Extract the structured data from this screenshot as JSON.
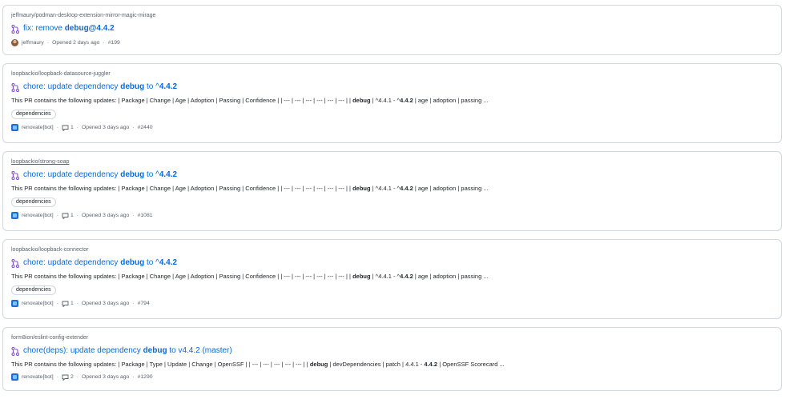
{
  "results": [
    {
      "repo": "jeffmaury/podman-desktop-extension-mirror-magic-mirage",
      "title_prefix": "fix: remove ",
      "title_bold": "debug@4.4.2",
      "title_suffix": "",
      "author": "jeffmaury",
      "opened": "Opened 2 days ago",
      "number": "#199"
    },
    {
      "repo": "loopbackio/loopback-datasource-juggler",
      "title_prefix": "chore: update dependency ",
      "title_bold": "debug",
      "title_mid": " to ^",
      "title_bold2": "4.4.2",
      "desc_pre": "This PR contains the following updates: | Package | Change | Age | Adoption | Passing | Confidence | | --- | --- | --- | --- | --- | --- | | ",
      "desc_b1": "debug",
      "desc_mid": " | ^4.4.1 - ^",
      "desc_b2": "4.4.2",
      "desc_post": " | age | adoption | passing ...",
      "label": "dependencies",
      "author": "renovate[bot]",
      "comments": "1",
      "opened": "Opened 3 days ago",
      "number": "#2440"
    },
    {
      "repo": "loopbackio/strong-soap",
      "title_prefix": "chore: update dependency ",
      "title_bold": "debug",
      "title_mid": " to ^",
      "title_bold2": "4.4.2",
      "desc_pre": "This PR contains the following updates: | Package | Change | Age | Adoption | Passing | Confidence | | --- | --- | --- | --- | --- | --- | | ",
      "desc_b1": "debug",
      "desc_mid": " | ^4.4.1 - ^",
      "desc_b2": "4.4.2",
      "desc_post": " | age | adoption | passing ...",
      "label": "dependencies",
      "author": "renovate[bot]",
      "comments": "1",
      "opened": "Opened 3 days ago",
      "number": "#1081"
    },
    {
      "repo": "loopbackio/loopback-connector",
      "title_prefix": "chore: update dependency ",
      "title_bold": "debug",
      "title_mid": " to ^",
      "title_bold2": "4.4.2",
      "desc_pre": "This PR contains the following updates: | Package | Change | Age | Adoption | Passing | Confidence | | --- | --- | --- | --- | --- | --- | | ",
      "desc_b1": "debug",
      "desc_mid": " | ^4.4.1 - ^",
      "desc_b2": "4.4.2",
      "desc_post": " | age | adoption | passing ...",
      "label": "dependencies",
      "author": "renovate[bot]",
      "comments": "1",
      "opened": "Opened 3 days ago",
      "number": "#794"
    },
    {
      "repo": "form8ion/eslint-config-extender",
      "title_prefix": "chore(deps): update dependency ",
      "title_bold": "debug",
      "title_mid": " to v4.4.2 (master)",
      "title_bold2": "",
      "desc_pre": "This PR contains the following updates: | Package | Type | Update | Change | OpenSSF | | --- | --- | --- | --- | --- | | ",
      "desc_b1": "debug",
      "desc_mid": " | devDependencies | patch | 4.4.1 - ",
      "desc_b2": "4.4.2",
      "desc_post": " | OpenSSF Scorecard ...",
      "author": "renovate[bot]",
      "comments": "2",
      "opened": "Opened 3 days ago",
      "number": "#1290"
    }
  ],
  "colors": {
    "link": "#0969da",
    "muted": "#59636e",
    "border": "#d0d7de",
    "open_icon": "#8250df"
  },
  "icons": {
    "pr": "git-pull-request-icon",
    "comment": "comment-icon"
  }
}
